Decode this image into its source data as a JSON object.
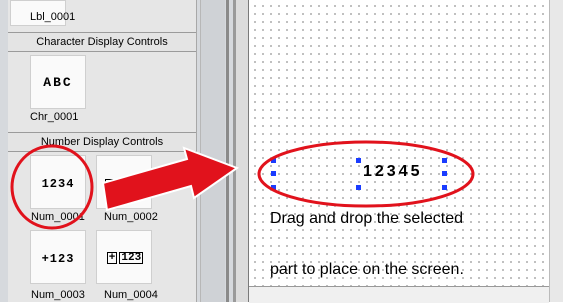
{
  "palette": {
    "label_top": "Lbl_0001",
    "categories": [
      {
        "title": "Character Display Controls"
      },
      {
        "title": "Number Display Controls"
      }
    ],
    "char_tiles": [
      {
        "preview": "ABC",
        "label": "Chr_0001"
      }
    ],
    "number_tiles": [
      {
        "preview": "1234",
        "label": "Num_0001"
      },
      {
        "preview": "",
        "label": "Num_0002"
      },
      {
        "preview": "+123",
        "label": "Num_0003"
      },
      {
        "preview_prefix": "+",
        "preview": "123",
        "label": "Num_0004"
      }
    ]
  },
  "canvas": {
    "selected_part_value": "12345",
    "instruction_line1": "Drag and drop the selected",
    "instruction_line2": "part to place on the screen."
  },
  "annotations": {
    "highlight_color": "#e1121c",
    "handle_color": "#1a3cff"
  }
}
